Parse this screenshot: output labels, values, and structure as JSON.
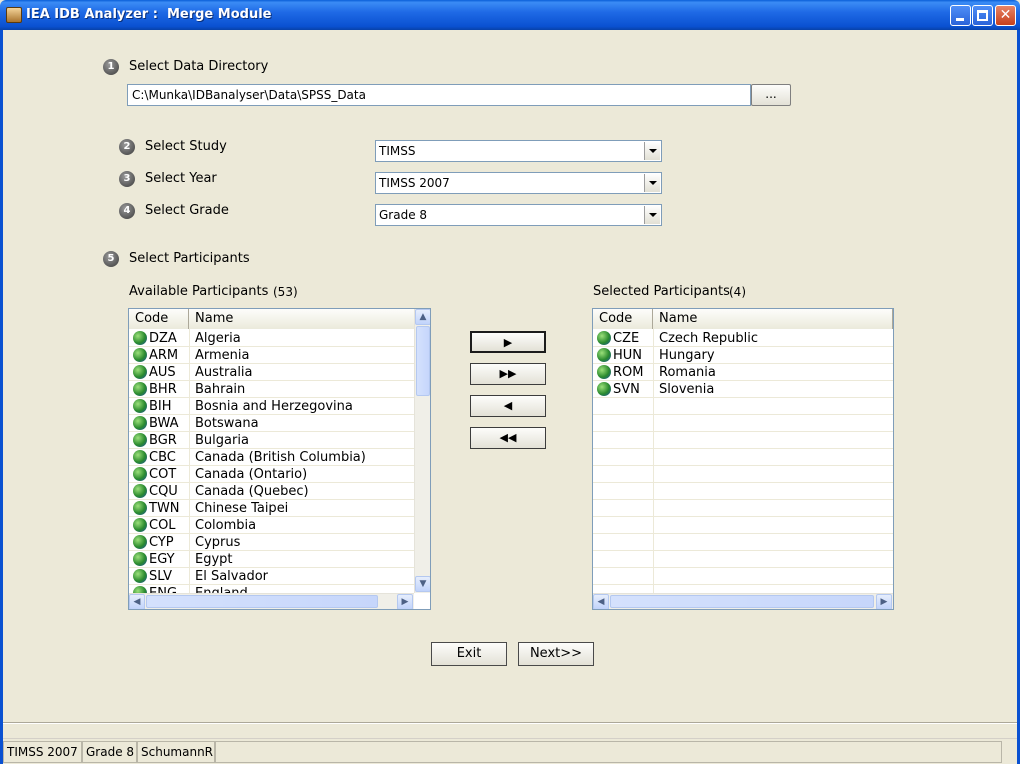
{
  "window": {
    "title": "IEA IDB Analyzer :  Merge Module"
  },
  "step1": {
    "number": "1",
    "label": "Select Data Directory",
    "path": "C:\\Munka\\IDBanalyser\\Data\\SPSS_Data",
    "browse_label": "..."
  },
  "step2": {
    "number": "2",
    "label": "Select Study",
    "value": "TIMSS"
  },
  "step3": {
    "number": "3",
    "label": "Select Year",
    "value": "TIMSS 2007"
  },
  "step4": {
    "number": "4",
    "label": "Select Grade",
    "value": "Grade 8"
  },
  "step5": {
    "number": "5",
    "label": "Select Participants"
  },
  "available": {
    "label": "Available Participants",
    "count": "(53)",
    "columns": {
      "code": "Code",
      "name": "Name"
    },
    "rows": [
      {
        "code": "DZA",
        "name": "Algeria"
      },
      {
        "code": "ARM",
        "name": "Armenia"
      },
      {
        "code": "AUS",
        "name": "Australia"
      },
      {
        "code": "BHR",
        "name": "Bahrain"
      },
      {
        "code": "BIH",
        "name": "Bosnia and Herzegovina"
      },
      {
        "code": "BWA",
        "name": "Botswana"
      },
      {
        "code": "BGR",
        "name": "Bulgaria"
      },
      {
        "code": "CBC",
        "name": "Canada (British Columbia)"
      },
      {
        "code": "COT",
        "name": "Canada (Ontario)"
      },
      {
        "code": "CQU",
        "name": "Canada (Quebec)"
      },
      {
        "code": "TWN",
        "name": "Chinese Taipei"
      },
      {
        "code": "COL",
        "name": "Colombia"
      },
      {
        "code": "CYP",
        "name": "Cyprus"
      },
      {
        "code": "EGY",
        "name": "Egypt"
      },
      {
        "code": "SLV",
        "name": "El Salvador"
      },
      {
        "code": "ENG",
        "name": "England"
      }
    ]
  },
  "selected": {
    "label": "Selected Participants",
    "count": "(4)",
    "columns": {
      "code": "Code",
      "name": "Name"
    },
    "rows": [
      {
        "code": "CZE",
        "name": "Czech Republic"
      },
      {
        "code": "HUN",
        "name": "Hungary"
      },
      {
        "code": "ROM",
        "name": "Romania"
      },
      {
        "code": "SVN",
        "name": "Slovenia"
      }
    ]
  },
  "move_buttons": {
    "add": "▶",
    "add_all": "▶▶",
    "remove": "◀",
    "remove_all": "◀◀"
  },
  "buttons": {
    "exit": "Exit",
    "next": "Next>>"
  },
  "statusbar": {
    "pane1": "TIMSS 2007",
    "pane2": "Grade 8",
    "pane3": "SchumannR"
  },
  "colors": {
    "titlebar": "#0a51d1",
    "face": "#ece9d8",
    "border": "#7f9db9"
  },
  "icons": {
    "app": "app-icon",
    "globe": "globe-icon",
    "step": "step-number-icon"
  }
}
